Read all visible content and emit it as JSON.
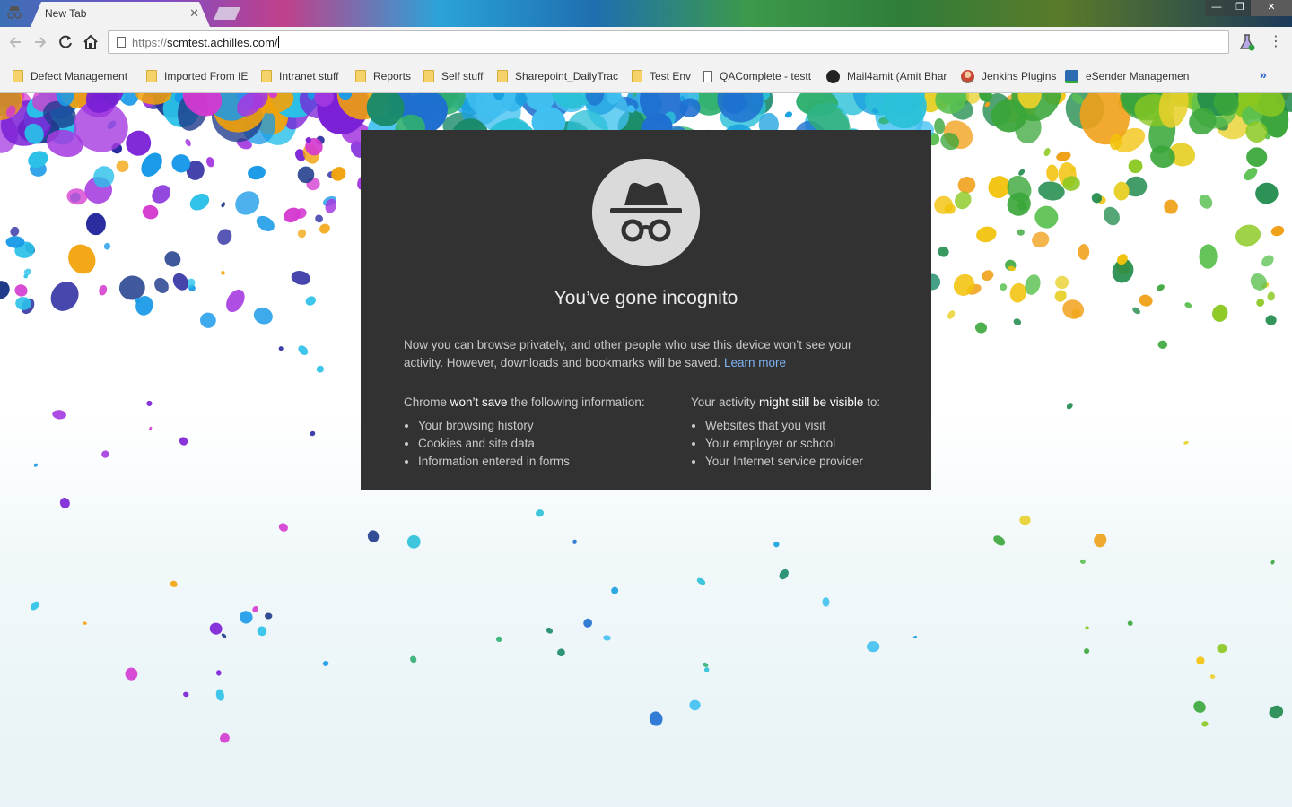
{
  "window": {
    "tab_title": "New Tab",
    "tab_close": "✕",
    "minimize": "—",
    "maximize": "❐",
    "close": "✕"
  },
  "toolbar": {
    "url_scheme": "https://",
    "url_host": "scmtest.achilles.com/",
    "back_icon": "arrow-left",
    "forward_icon": "arrow-right",
    "reload_icon": "reload",
    "home_icon": "home",
    "menu_icon": "⋮"
  },
  "bookmarks": {
    "items": [
      {
        "label": "Defect Management",
        "icon": "folder"
      },
      {
        "label": "Imported From IE",
        "icon": "folder"
      },
      {
        "label": "Intranet stuff",
        "icon": "folder"
      },
      {
        "label": "Reports",
        "icon": "folder"
      },
      {
        "label": "Self stuff",
        "icon": "folder"
      },
      {
        "label": "Sharepoint_DailyTrac",
        "icon": "folder"
      },
      {
        "label": "Test Env",
        "icon": "folder"
      },
      {
        "label": "QAComplete - testt",
        "icon": "doc"
      },
      {
        "label": "Mail4amit (Amit Bhar",
        "icon": "github"
      },
      {
        "label": "Jenkins Plugins",
        "icon": "person"
      },
      {
        "label": "eSender Managemen",
        "icon": "monitor"
      }
    ],
    "overflow": "»"
  },
  "incognito": {
    "title": "You’ve gone incognito",
    "description": "Now you can browse privately, and other people who use this device won’t see your activity. However, downloads and bookmarks will be saved.",
    "learn_more": "Learn more",
    "left_heading_pre": "Chrome ",
    "left_heading_bold": "won’t save",
    "left_heading_post": " the following information:",
    "left_items": [
      "Your browsing history",
      "Cookies and site data",
      "Information entered in forms"
    ],
    "right_heading_pre": "Your activity ",
    "right_heading_bold": "might still be visible",
    "right_heading_post": " to:",
    "right_items": [
      "Websites that you visit",
      "Your employer or school",
      "Your Internet service provider"
    ]
  },
  "colors": {
    "card_bg": "#323232",
    "link": "#7fb4f5",
    "hero_circle": "#dadada"
  }
}
